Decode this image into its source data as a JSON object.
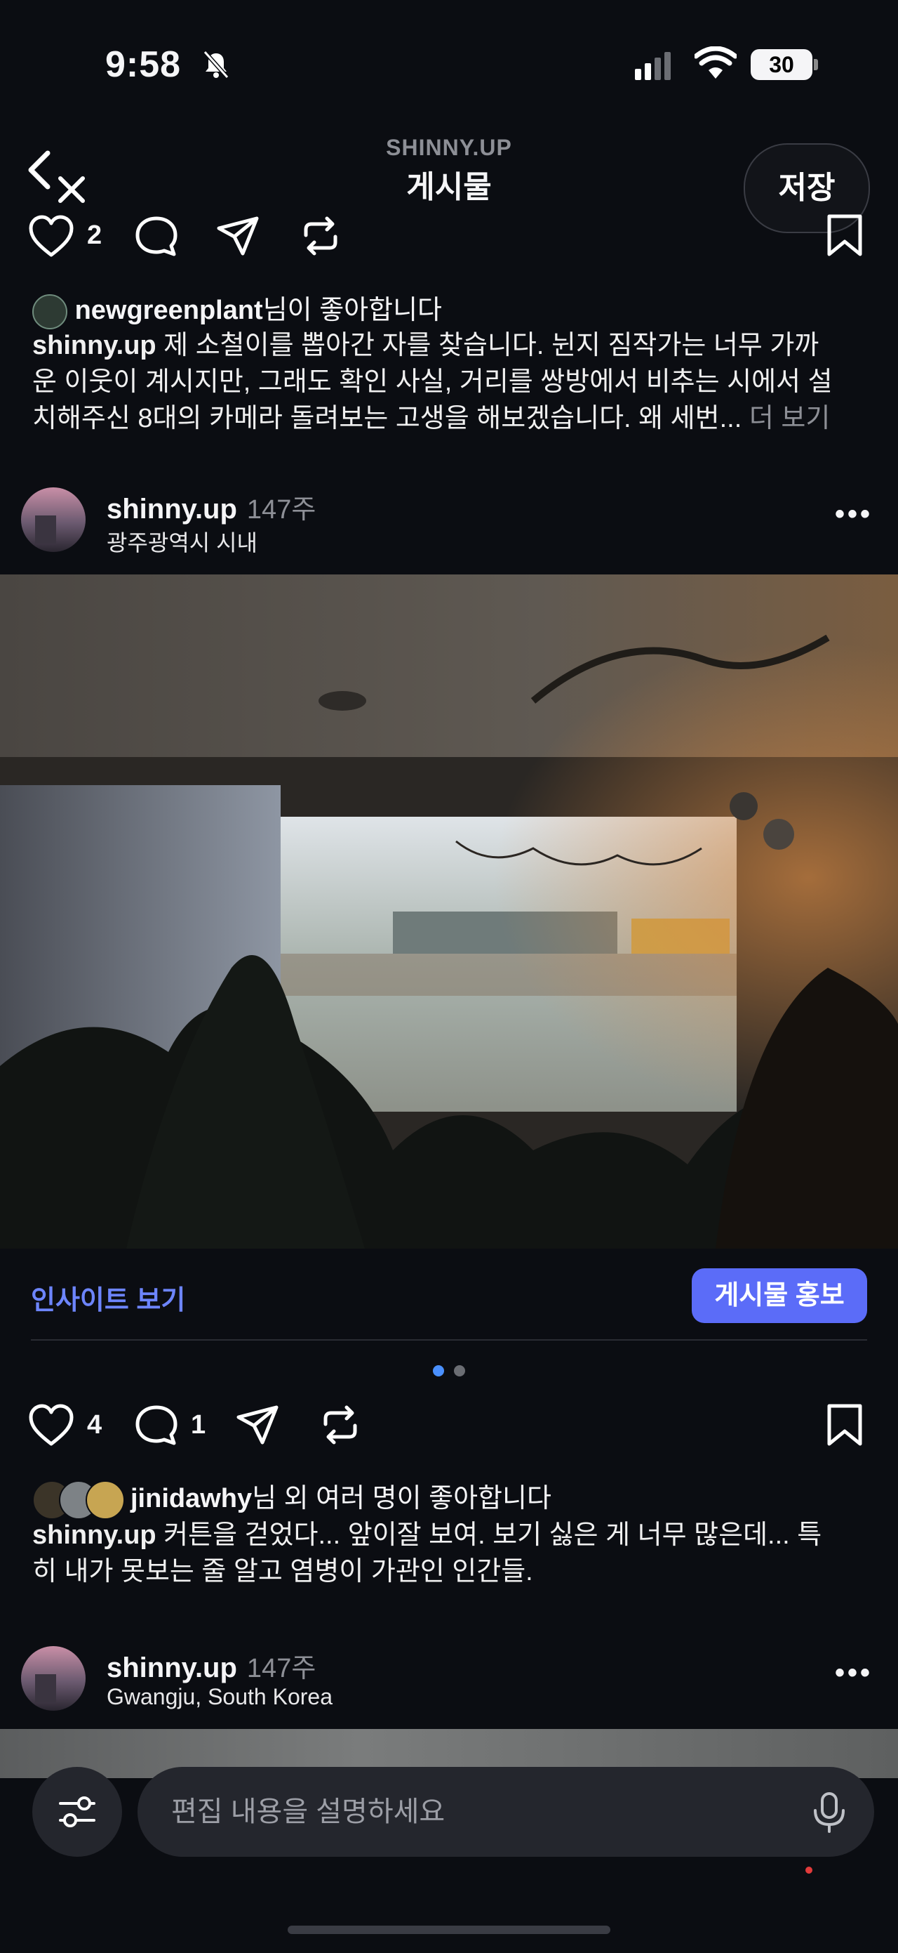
{
  "status_bar": {
    "time": "9:58",
    "battery": "30"
  },
  "header": {
    "account": "SHINNY.UP",
    "title": "게시물",
    "save_label": "저장"
  },
  "post1": {
    "like_count": "2",
    "liked_by": {
      "name": "newgreenplant",
      "suffix": "님이 좋아합니다"
    },
    "caption": {
      "author": "shinny.up",
      "line1": " 제 소철이를 뽑아간 자를 찾습니다. 뉜지 짐작가는 너무 가까",
      "line2": "운 이웃이 계시지만, 그래도 확인 사실, 거리를 쌍방에서 비추는 시에서 설",
      "line3": "치해주신 8대의 카메라 돌려보는 고생을 해보겠습니다. 왜 세번...",
      "more": " 더 보기"
    }
  },
  "post2": {
    "author": "shinny.up",
    "age": "147주",
    "location": "광주광역시 시내",
    "insight_label": "인사이트 보기",
    "promote_label": "게시물 홍보",
    "like_count": "4",
    "comment_count": "1",
    "liked_by": {
      "name": "jinidawhy",
      "suffix": "님 외 여러 명이 좋아합니다"
    },
    "caption": {
      "author": "shinny.up",
      "line1": " 커튼을 걷었다... 앞이잘 보여. 보기 싫은 게 너무 많은데... 특",
      "line2": "히 내가 못보는 줄 알고 염병이 가관인 인간들."
    }
  },
  "post3": {
    "author": "shinny.up",
    "age": "147주",
    "location": "Gwangju, South Korea"
  },
  "edit_bar": {
    "placeholder": "편집 내용을 설명하세요"
  },
  "colors": {
    "background": "#0b0d12",
    "accent": "#5b6cf8",
    "link": "#6d85ff",
    "muted": "#8d8f96"
  }
}
